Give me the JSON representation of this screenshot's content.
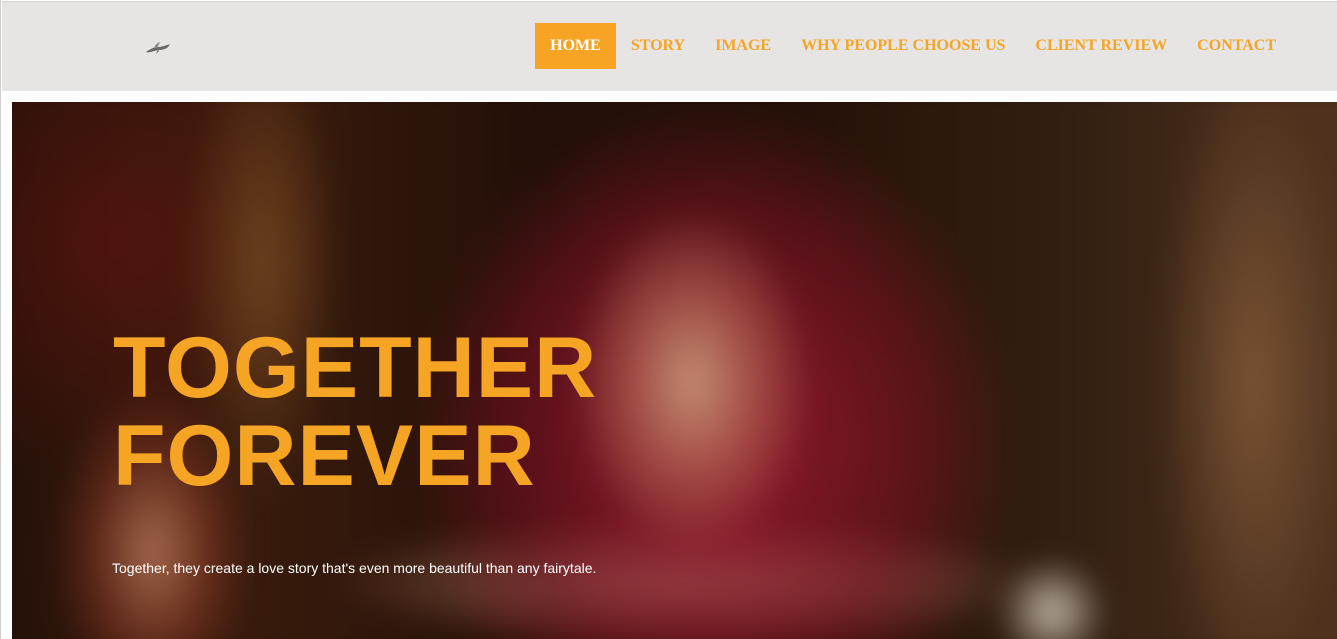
{
  "header": {
    "logo_icon": "dove-icon",
    "nav": [
      {
        "label": "HOME",
        "active": true
      },
      {
        "label": "STORY",
        "active": false
      },
      {
        "label": "IMAGE",
        "active": false
      },
      {
        "label": "WHY PEOPLE CHOOSE US",
        "active": false
      },
      {
        "label": "CLIENT REVIEW",
        "active": false
      },
      {
        "label": "CONTACT",
        "active": false
      }
    ]
  },
  "hero": {
    "title_line1": "TOGETHER",
    "title_line2": "FOREVER",
    "subtitle": "Together, they create a love story that's even more beautiful than any fairytale.",
    "background": "blurred-bride-photo"
  },
  "colors": {
    "accent": "#f7a324",
    "navbar_bg": "#e6e5e4",
    "active_text": "#ffffff"
  }
}
